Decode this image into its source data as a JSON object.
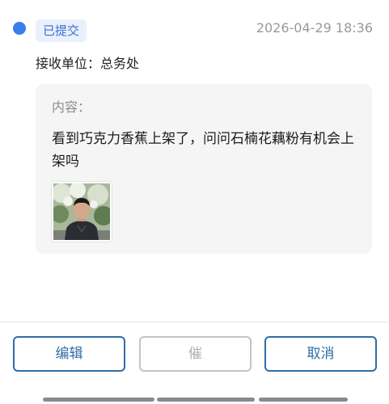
{
  "status": {
    "label": "已提交",
    "color": "#3b7ded"
  },
  "timestamp": "2026-04-29 18:36",
  "recipient": {
    "text": "接收单位：总务处"
  },
  "content": {
    "label": "内容：",
    "text": "看到巧克力香蕉上架了，问问石楠花藕粉有机会上架吗",
    "attachment": {
      "icon": "photo-thumbnail"
    }
  },
  "actions": {
    "edit_label": "编辑",
    "urge_label": "催",
    "cancel_label": "取消",
    "accent_color": "#2f6ea8",
    "disabled_color": "#b0b0b0"
  }
}
